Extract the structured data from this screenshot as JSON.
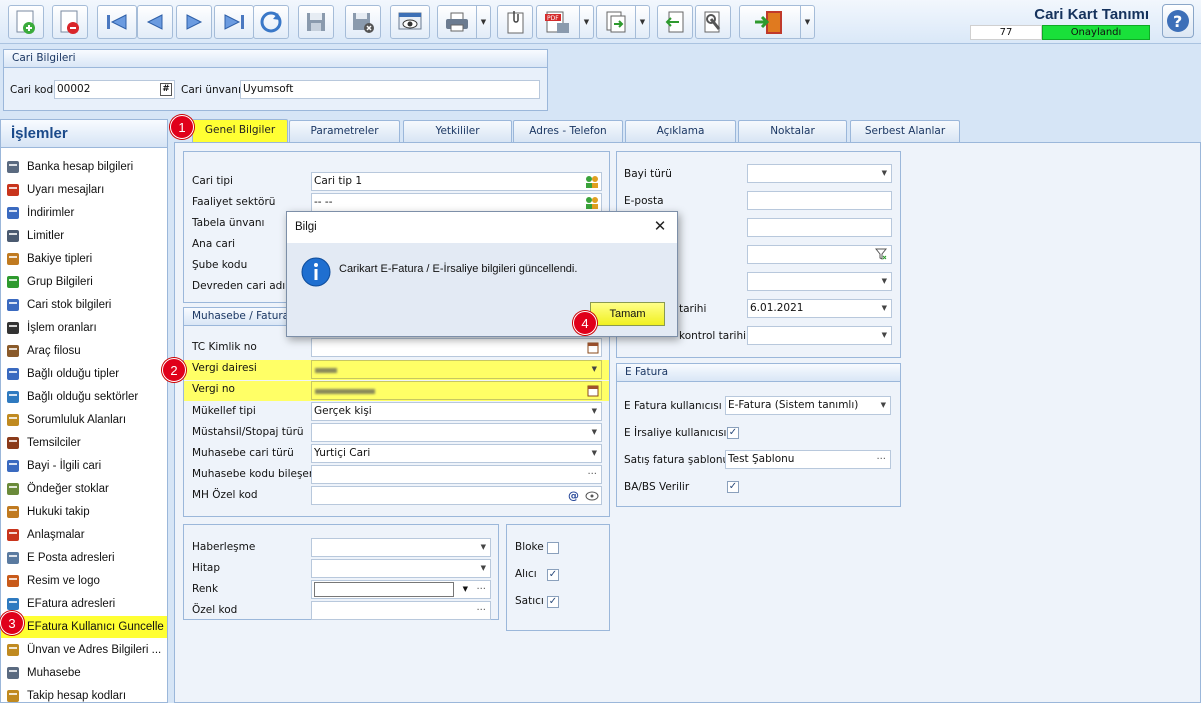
{
  "toolbar": {
    "title": "Cari Kart Tanımı",
    "record_number": "77",
    "status": "Onaylandı",
    "icons": [
      "new-icon",
      "delete-icon",
      "first-icon",
      "prev-icon",
      "next-icon",
      "last-icon",
      "refresh-icon",
      "save-icon",
      "save-close-icon",
      "cancel-save-icon",
      "preview-icon",
      "print-icon",
      "attach-icon",
      "pdf-icon",
      "export-icon",
      "import-icon",
      "tools-icon",
      "exit-icon",
      "help-icon"
    ]
  },
  "cari_bilgileri": {
    "header": "Cari Bilgileri",
    "kod_label": "Cari kod",
    "kod_value": "00002",
    "unvan_label": "Cari ünvanı",
    "unvan_value": "Uyumsoft"
  },
  "sidebar": {
    "header": "İşlemler",
    "items": [
      {
        "label": "Banka hesap bilgileri",
        "icon": "bank-icon"
      },
      {
        "label": "Uyarı mesajları",
        "icon": "warning-icon"
      },
      {
        "label": "İndirimler",
        "icon": "discount-icon"
      },
      {
        "label": "Limitler",
        "icon": "limit-icon"
      },
      {
        "label": "Bakiye tipleri",
        "icon": "balance-icon"
      },
      {
        "label": "Grup Bilgileri",
        "icon": "group-icon"
      },
      {
        "label": "Cari stok bilgileri",
        "icon": "stock-icon"
      },
      {
        "label": "İşlem oranları",
        "icon": "percent-icon"
      },
      {
        "label": "Araç filosu",
        "icon": "vehicle-icon"
      },
      {
        "label": "Bağlı olduğu tipler",
        "icon": "type-icon"
      },
      {
        "label": "Bağlı olduğu sektörler",
        "icon": "sector-icon"
      },
      {
        "label": "Sorumluluk Alanları",
        "icon": "responsibility-icon"
      },
      {
        "label": "Temsilciler",
        "icon": "person-icon"
      },
      {
        "label": "Bayi - İlgili cari",
        "icon": "dealer-icon"
      },
      {
        "label": "Öndeğer stoklar",
        "icon": "default-stock-icon"
      },
      {
        "label": "Hukuki takip",
        "icon": "legal-icon"
      },
      {
        "label": "Anlaşmalar",
        "icon": "agreement-icon"
      },
      {
        "label": "E Posta adresleri",
        "icon": "email-icon"
      },
      {
        "label": "Resim ve logo",
        "icon": "image-icon"
      },
      {
        "label": "EFatura adresleri",
        "icon": "efatura-address-icon"
      },
      {
        "label": "EFatura Kullanıcı Guncelle",
        "icon": "efatura-update-icon"
      },
      {
        "label": "Ünvan ve Adres Bilgileri ...",
        "icon": "title-address-icon"
      },
      {
        "label": "Muhasebe",
        "icon": "accounting-icon"
      },
      {
        "label": "Takip hesap kodları",
        "icon": "tracking-code-icon"
      }
    ]
  },
  "tabs": [
    "Genel Bilgiler",
    "Parametreler",
    "Yetkililer",
    "Adres - Telefon",
    "Açıklama",
    "Noktalar",
    "Serbest Alanlar"
  ],
  "genel": {
    "cari_tipi_label": "Cari tipi",
    "cari_tipi_value": "Cari tip 1",
    "faaliyet_label": "Faaliyet sektörü",
    "faaliyet_value": "-- --",
    "tabela_label": "Tabela ünvanı",
    "ana_cari_label": "Ana cari",
    "sube_label": "Şube kodu",
    "devreden_label": "Devreden cari adı"
  },
  "muhasebe": {
    "header": "Muhasebe / Fatura",
    "tc_label": "TC Kimlik no",
    "vergi_dairesi_label": "Vergi dairesi",
    "vergi_no_label": "Vergi no",
    "mukellef_label": "Mükellef tipi",
    "mukellef_value": "Gerçek kişi",
    "mustahsil_label": "Müstahsil/Stopaj türü",
    "muh_cari_label": "Muhasebe cari türü",
    "muh_cari_value": "Yurtiçi Cari",
    "muh_kod_label": "Muhasebe kodu bileşeni",
    "mh_ozel_label": "MH Özel kod"
  },
  "iletisim": {
    "haberlesme_label": "Haberleşme",
    "hitap_label": "Hitap",
    "renk_label": "Renk",
    "ozel_kod_label": "Özel kod"
  },
  "flags": {
    "bloke_label": "Bloke",
    "bloke": false,
    "alici_label": "Alıcı",
    "alici": true,
    "satici_label": "Satıcı",
    "satici": true
  },
  "right": {
    "bayi_label": "Bayi türü",
    "eposta_label": "E-posta",
    "tarih_label": "tarihi",
    "tarih_value": "6.01.2021",
    "kontrol_label": "kontrol tarihi"
  },
  "efatura": {
    "header": "E Fatura",
    "kullanici_label": "E Fatura kullanıcısı",
    "kullanici_value": "E-Fatura (Sistem tanımlı)",
    "irsaliye_label": "E İrsaliye kullanıcısı",
    "irsaliye": true,
    "sablon_label": "Satış fatura şablonu",
    "sablon_value": "Test Şablonu",
    "babs_label": "BA/BS Verilir",
    "babs": true
  },
  "dialog": {
    "title": "Bilgi",
    "message": "Carikart E-Fatura / E-İrsaliye bilgileri güncellendi.",
    "ok_label": "Tamam"
  },
  "badges": [
    "1",
    "2",
    "3",
    "4"
  ]
}
